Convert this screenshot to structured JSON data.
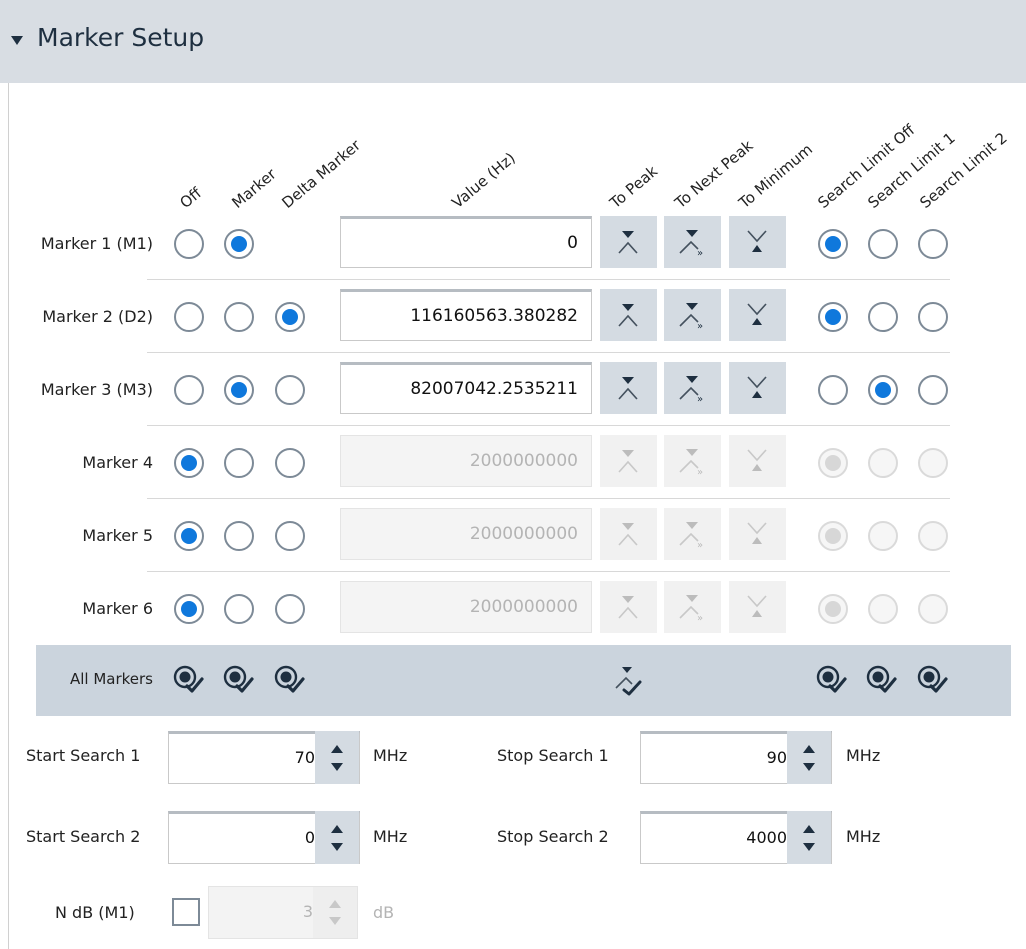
{
  "panel": {
    "title": "Marker Setup"
  },
  "columns": {
    "off": "Off",
    "marker": "Marker",
    "delta_marker": "Delta Marker",
    "value": "Value (Hz)",
    "to_peak": "To Peak",
    "to_next_peak": "To Next Peak",
    "to_minimum": "To Minimum",
    "search_limit_off": "Search Limit Off",
    "search_limit_1": "Search Limit 1",
    "search_limit_2": "Search Limit 2"
  },
  "markers": [
    {
      "label": "Marker 1 (M1)",
      "value": "0",
      "mode": "marker",
      "search_limit": "off",
      "enabled": true,
      "has_delta": false
    },
    {
      "label": "Marker 2 (D2)",
      "value": "116160563.380282",
      "mode": "delta",
      "search_limit": "off",
      "enabled": true,
      "has_delta": true
    },
    {
      "label": "Marker 3 (M3)",
      "value": "82007042.2535211",
      "mode": "marker",
      "search_limit": "1",
      "enabled": true,
      "has_delta": true
    },
    {
      "label": "Marker 4",
      "value": "2000000000",
      "mode": "off",
      "search_limit": "off",
      "enabled": false,
      "has_delta": true
    },
    {
      "label": "Marker 5",
      "value": "2000000000",
      "mode": "off",
      "search_limit": "off",
      "enabled": false,
      "has_delta": true
    },
    {
      "label": "Marker 6",
      "value": "2000000000",
      "mode": "off",
      "search_limit": "off",
      "enabled": false,
      "has_delta": true
    }
  ],
  "all_markers": {
    "label": "All Markers"
  },
  "search": {
    "start1": {
      "label": "Start Search 1",
      "value": "70",
      "unit": "MHz"
    },
    "stop1": {
      "label": "Stop Search 1",
      "value": "90",
      "unit": "MHz"
    },
    "start2": {
      "label": "Start Search 2",
      "value": "0",
      "unit": "MHz"
    },
    "stop2": {
      "label": "Stop Search 2",
      "value": "4000",
      "unit": "MHz"
    }
  },
  "ndb": {
    "label": "N dB (M1)",
    "value": "3",
    "unit": "dB",
    "checked": false
  },
  "icons": {
    "collapse": "collapse-triangle-icon",
    "to_peak": "to-peak-icon",
    "to_next_peak": "to-next-peak-icon",
    "to_minimum": "to-minimum-icon",
    "select_all": "select-all-check-icon"
  },
  "colors": {
    "accent": "#0f78dc",
    "header_bg": "#d8dde3",
    "button_bg": "#d4dbe2",
    "all_bar_bg": "#cbd4dd"
  }
}
